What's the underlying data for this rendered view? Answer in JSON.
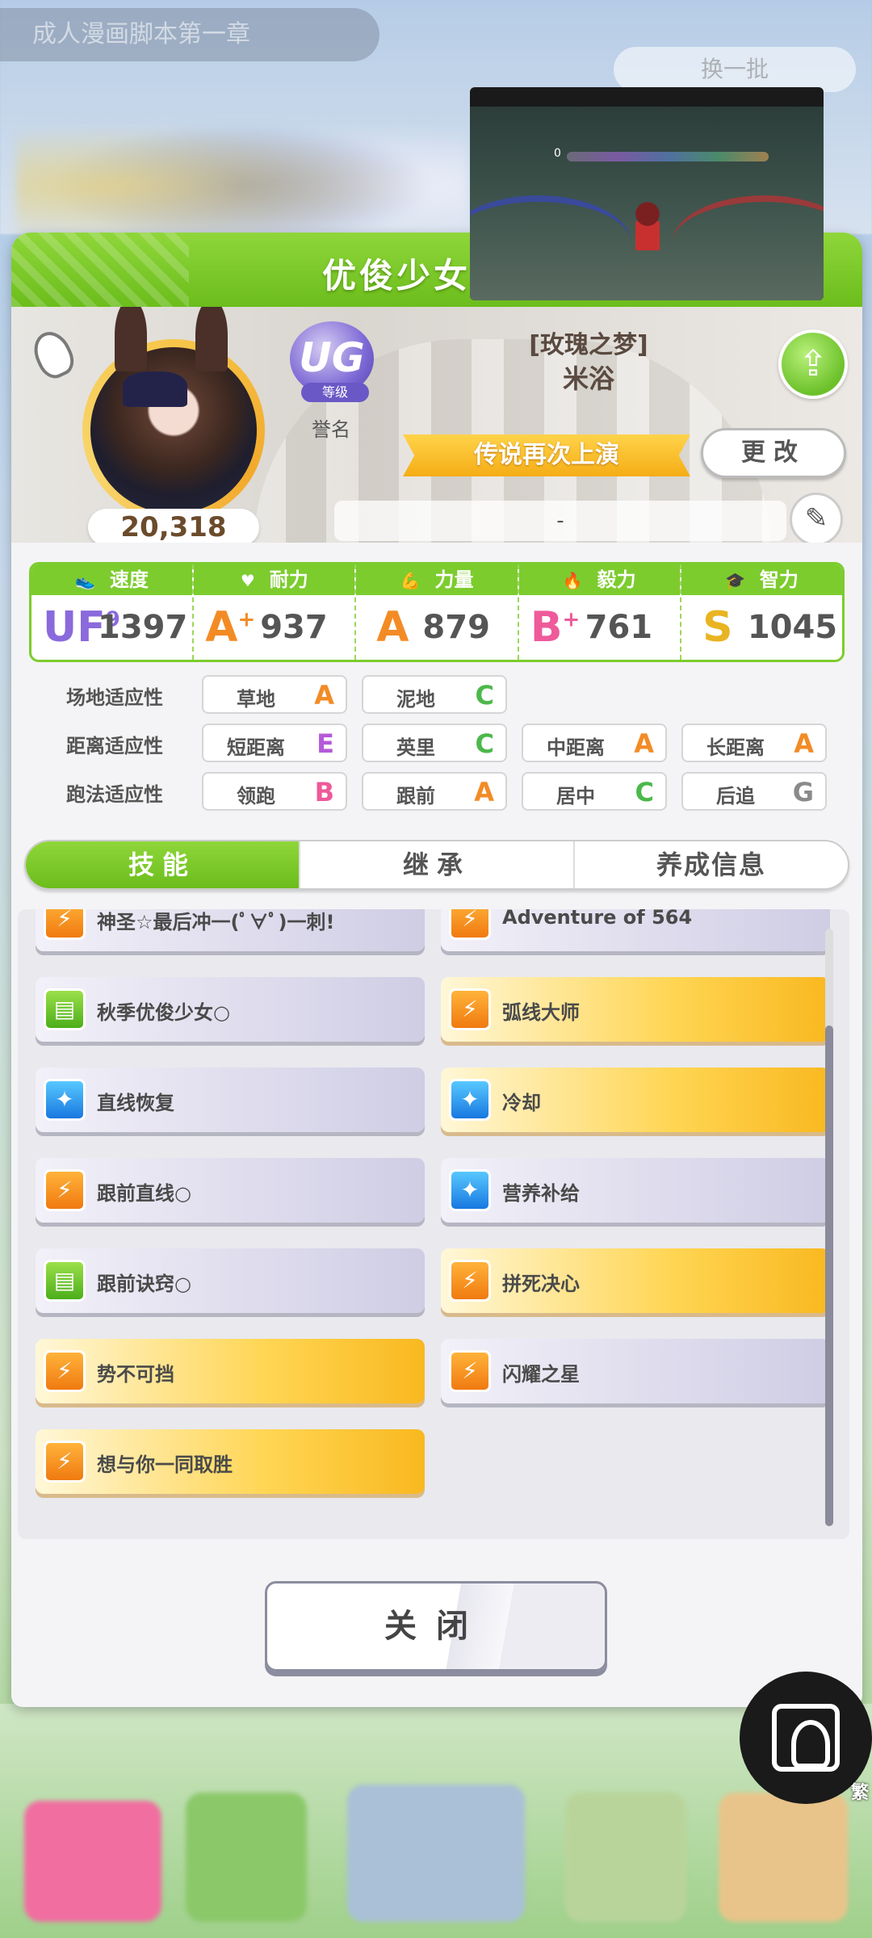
{
  "background": {
    "title": "成人漫画脚本第一章",
    "pill": "换一批"
  },
  "video": {
    "counter": "0"
  },
  "panel": {
    "title": "优俊少女"
  },
  "profile": {
    "fans": "20,318",
    "rank_badge": "UG",
    "rank_tag": "等级",
    "rank_label": "誉名",
    "title_bracket": "[玫瑰之梦]",
    "name": "米浴",
    "ribbon": "传说再次上演",
    "change_button": "更改",
    "comment": "-"
  },
  "stats": [
    {
      "name": "速度",
      "icon": "shoe",
      "grade": "UF",
      "grade_sup": "9",
      "value": "1397",
      "color": "#8a6adc"
    },
    {
      "name": "耐力",
      "icon": "heart",
      "grade": "A",
      "grade_sup": "+",
      "value": "937",
      "color": "#f38b25"
    },
    {
      "name": "力量",
      "icon": "muscle",
      "grade": "A",
      "grade_sup": "",
      "value": "879",
      "color": "#f38b25"
    },
    {
      "name": "毅力",
      "icon": "flame",
      "grade": "B",
      "grade_sup": "+",
      "value": "761",
      "color": "#ee5a9a"
    },
    {
      "name": "智力",
      "icon": "graduation-cap",
      "grade": "S",
      "grade_sup": "",
      "value": "1045",
      "color": "#e9b422"
    }
  ],
  "aptitude": {
    "track": {
      "label": "场地适应性",
      "items": [
        {
          "name": "草地",
          "grade": "A"
        },
        {
          "name": "泥地",
          "grade": "C"
        }
      ]
    },
    "distance": {
      "label": "距离适应性",
      "items": [
        {
          "name": "短距离",
          "grade": "E"
        },
        {
          "name": "英里",
          "grade": "C"
        },
        {
          "name": "中距离",
          "grade": "A"
        },
        {
          "name": "长距离",
          "grade": "A"
        }
      ]
    },
    "style": {
      "label": "跑法适应性",
      "items": [
        {
          "name": "领跑",
          "grade": "B"
        },
        {
          "name": "跟前",
          "grade": "A"
        },
        {
          "name": "居中",
          "grade": "C"
        },
        {
          "name": "后追",
          "grade": "G"
        }
      ]
    }
  },
  "grade_colors": {
    "A": "#f38b25",
    "B": "#ee5a9a",
    "C": "#4cb84a",
    "E": "#b45ad8",
    "G": "#8a8a8a"
  },
  "tabs": [
    "技能",
    "继承",
    "养成信息"
  ],
  "skills": [
    {
      "name": "神圣☆最后冲一(ﾟ∀ﾟ)一刺!",
      "icon": "orange",
      "gold": false
    },
    {
      "name": "Adventure of 564",
      "icon": "orange",
      "gold": false
    },
    {
      "name": "秋季优俊少女○",
      "icon": "green",
      "gold": false
    },
    {
      "name": "弧线大师",
      "icon": "orange",
      "gold": true
    },
    {
      "name": "直线恢复",
      "icon": "blue",
      "gold": false
    },
    {
      "name": "冷却",
      "icon": "blue",
      "gold": true
    },
    {
      "name": "跟前直线○",
      "icon": "orange",
      "gold": false
    },
    {
      "name": "营养补给",
      "icon": "blue",
      "gold": false
    },
    {
      "name": "跟前诀窍○",
      "icon": "green",
      "gold": false
    },
    {
      "name": "拼死决心",
      "icon": "orange",
      "gold": true
    },
    {
      "name": "势不可挡",
      "icon": "orange",
      "gold": true
    },
    {
      "name": "闪耀之星",
      "icon": "orange",
      "gold": false
    },
    {
      "name": "想与你一同取胜",
      "icon": "orange",
      "gold": true
    }
  ],
  "close_button": "关闭",
  "overlay": {
    "trad_label": "繁"
  }
}
